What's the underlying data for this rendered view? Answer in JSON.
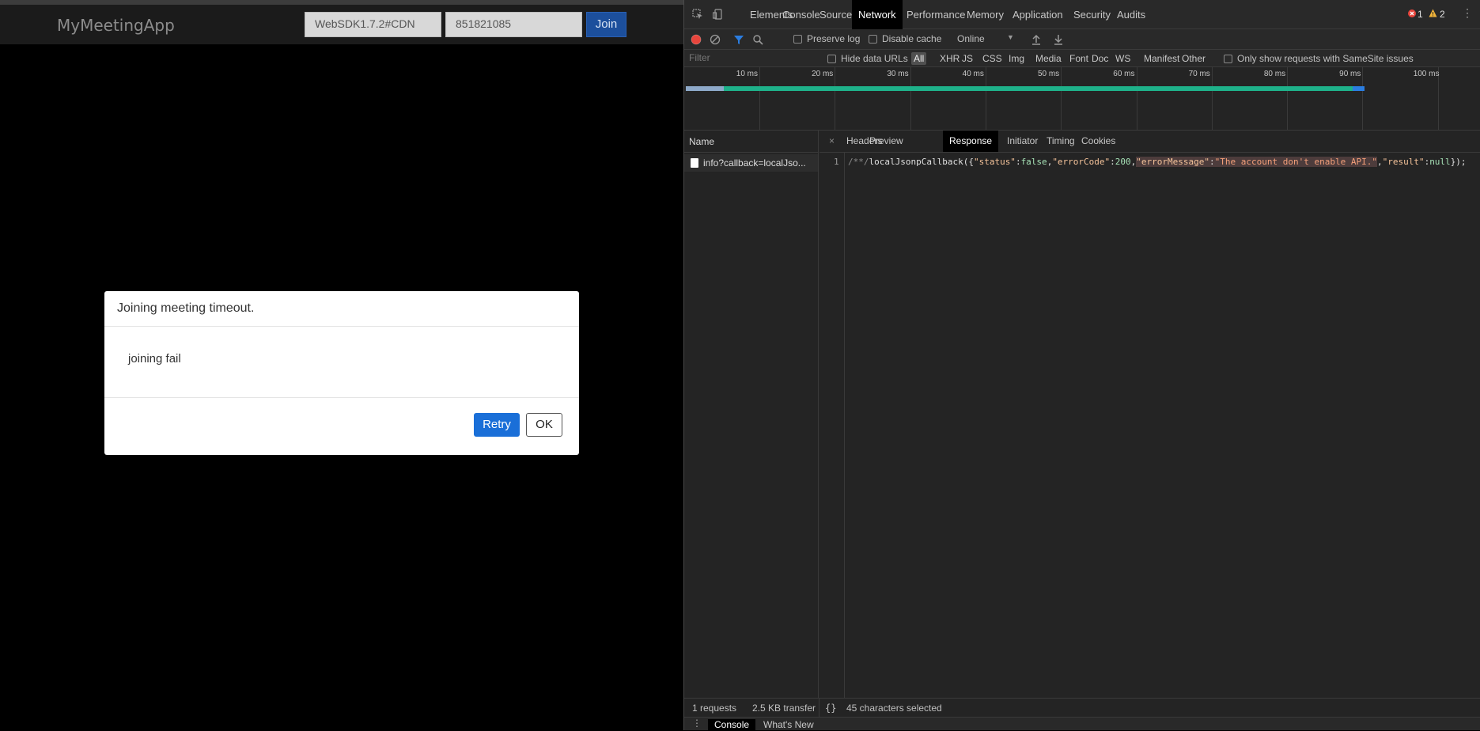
{
  "app": {
    "brand": "MyMeetingApp",
    "sdk_input_value": "WebSDK1.7.2#CDN",
    "meeting_id_value": "851821085",
    "join_label": "Join"
  },
  "modal": {
    "title": "Joining meeting timeout.",
    "body": "joining fail",
    "retry_label": "Retry",
    "ok_label": "OK"
  },
  "devtools": {
    "tabs": [
      "Elements",
      "Console",
      "Sources",
      "Network",
      "Performance",
      "Memory",
      "Application",
      "Security",
      "Audits"
    ],
    "active_tab": "Network",
    "error_count": "1",
    "warning_count": "2",
    "toolbar": {
      "preserve_log": "Preserve log",
      "disable_cache": "Disable cache",
      "throttle": "Online"
    },
    "filter": {
      "placeholder": "Filter",
      "hide_data_urls": "Hide data URLs",
      "types": [
        "All",
        "XHR",
        "JS",
        "CSS",
        "Img",
        "Media",
        "Font",
        "Doc",
        "WS",
        "Manifest",
        "Other"
      ],
      "samesite": "Only show requests with SameSite issues"
    },
    "timeline_ticks": [
      "10 ms",
      "20 ms",
      "30 ms",
      "40 ms",
      "50 ms",
      "60 ms",
      "70 ms",
      "80 ms",
      "90 ms",
      "100 ms"
    ],
    "name_header": "Name",
    "request_name": "info?callback=localJso...",
    "detail_tabs": [
      "Headers",
      "Preview",
      "Response",
      "Initiator",
      "Timing",
      "Cookies"
    ],
    "active_detail_tab": "Response",
    "close_symbol": "×",
    "line_number": "1",
    "response": {
      "comment": "/**/",
      "fn": "localJsonpCallback({",
      "k_status": "\"status\"",
      "v_status": "false",
      "k_errorCode": "\"errorCode\"",
      "v_errorCode": "200",
      "k_errorMessage": "\"errorMessage\"",
      "v_errorMessage": "\"The account don't enable API.\"",
      "k_result": "\"result\"",
      "v_result": "null",
      "tail": "});"
    },
    "status": {
      "requests": "1 requests",
      "transferred": "2.5 KB transfer",
      "braces": "{}",
      "selection": "45 characters selected"
    },
    "drawer_tabs": [
      "Console",
      "What's New"
    ]
  },
  "colors": {
    "accent_blue": "#1a6fd8",
    "devtools_bg": "#242424",
    "waterfall_green": "#1eb18a",
    "waterfall_blue": "#2b7de0"
  }
}
